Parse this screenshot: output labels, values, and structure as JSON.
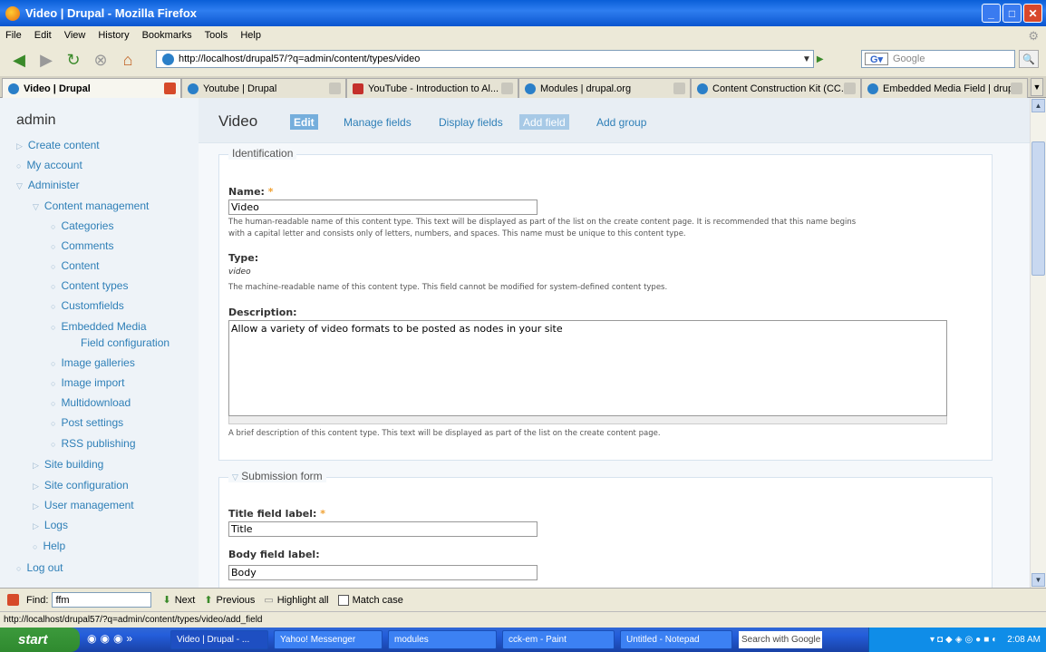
{
  "window": {
    "title": "Video | Drupal - Mozilla Firefox"
  },
  "menubar": [
    "File",
    "Edit",
    "View",
    "History",
    "Bookmarks",
    "Tools",
    "Help"
  ],
  "address": {
    "url": "http://localhost/drupal57/?q=admin/content/types/video"
  },
  "search": {
    "placeholder": "Google"
  },
  "tabs": [
    {
      "label": "Video | Drupal"
    },
    {
      "label": "Youtube | Drupal"
    },
    {
      "label": "YouTube - Introduction to Al..."
    },
    {
      "label": "Modules | drupal.org"
    },
    {
      "label": "Content Construction Kit (CC..."
    },
    {
      "label": "Embedded Media Field | drup..."
    }
  ],
  "sidebar": {
    "title": "admin",
    "items": [
      {
        "label": "Create content"
      },
      {
        "label": "My account"
      },
      {
        "label": "Administer"
      },
      {
        "label": "Content management"
      },
      {
        "label": "Categories"
      },
      {
        "label": "Comments"
      },
      {
        "label": "Content"
      },
      {
        "label": "Content types"
      },
      {
        "label": "Customfields"
      },
      {
        "label": "Embedded Media"
      },
      {
        "label": "Field configuration"
      },
      {
        "label": "Image galleries"
      },
      {
        "label": "Image import"
      },
      {
        "label": "Multidownload"
      },
      {
        "label": "Post settings"
      },
      {
        "label": "RSS publishing"
      },
      {
        "label": "Site building"
      },
      {
        "label": "Site configuration"
      },
      {
        "label": "User management"
      },
      {
        "label": "Logs"
      },
      {
        "label": "Help"
      },
      {
        "label": "Log out"
      }
    ]
  },
  "page": {
    "title": "Video",
    "tabs": [
      "Edit",
      "Manage fields",
      "Display fields",
      "Add field",
      "Add group"
    ]
  },
  "identification": {
    "legend": "Identification",
    "name_label": "Name:",
    "required": "*",
    "name_value": "Video",
    "name_desc_1": "The human-readable name of this content type. This text will be displayed as part of the list on the create content page. It is recommended that this name begins",
    "name_desc_2": "with a capital letter and consists only of letters, numbers, and spaces. This name must be unique to this content type.",
    "type_label": "Type:",
    "type_value": "video",
    "type_desc": "The machine-readable name of this content type. This field cannot be modified for system-defined content types.",
    "desc_label": "Description:",
    "desc_value": "Allow a variety of video formats to be posted as nodes in your site",
    "desc_desc": "A brief description of this content type. This text will be displayed as part of the list on the create content page."
  },
  "submission": {
    "legend": "Submission form",
    "title_label": "Title field label:",
    "title_value": "Title",
    "body_label": "Body field label:",
    "body_value": "Body"
  },
  "findbar": {
    "label": "Find:",
    "value": "ffm",
    "next": "Next",
    "previous": "Previous",
    "highlight": "Highlight all",
    "matchcase": "Match case"
  },
  "status": {
    "text": "http://localhost/drupal57/?q=admin/content/types/video/add_field"
  },
  "taskbar": {
    "start": "start",
    "items": [
      "Video | Drupal - ...",
      "Yahoo! Messenger",
      "modules",
      "cck-em - Paint",
      "Untitled - Notepad"
    ],
    "search": "Search with Google",
    "clock": "2:08 AM"
  },
  "colors": {
    "link": "#2e7fb7",
    "active_tab": "#75aedc",
    "titlebar": "#0a5fd8"
  }
}
